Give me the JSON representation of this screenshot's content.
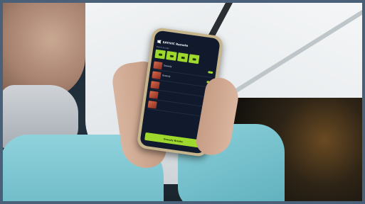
{
  "phone_app": {
    "app_title": "SATIVIC Remote",
    "section_label": "Quick access",
    "quick_buttons": [
      "btn1",
      "btn2",
      "btn3",
      "btn4"
    ],
    "rows": [
      {
        "title": "Orawdy",
        "subtitle": ""
      },
      {
        "title": "Orawdy",
        "subtitle": ""
      },
      {
        "title": "",
        "subtitle": ""
      },
      {
        "title": "",
        "subtitle": ""
      },
      {
        "title": "",
        "subtitle": ""
      }
    ],
    "cta_label": "Orawdy Breaks"
  },
  "colors": {
    "accent_green": "#9fd82c",
    "screen_bg": "#101a2c",
    "phone_case": "#c6b48c",
    "sleeve": "#8bd0da"
  }
}
